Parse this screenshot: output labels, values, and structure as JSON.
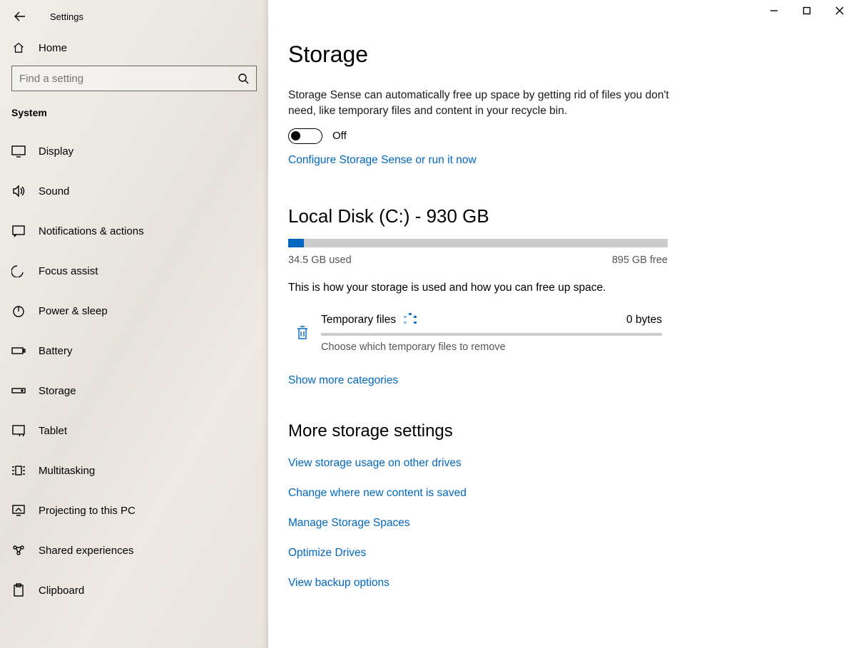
{
  "window": {
    "title": "Settings"
  },
  "sidebar": {
    "home_label": "Home",
    "search_placeholder": "Find a setting",
    "section_label": "System",
    "items": [
      {
        "label": "Display"
      },
      {
        "label": "Sound"
      },
      {
        "label": "Notifications & actions"
      },
      {
        "label": "Focus assist"
      },
      {
        "label": "Power & sleep"
      },
      {
        "label": "Battery"
      },
      {
        "label": "Storage"
      },
      {
        "label": "Tablet"
      },
      {
        "label": "Multitasking"
      },
      {
        "label": "Projecting to this PC"
      },
      {
        "label": "Shared experiences"
      },
      {
        "label": "Clipboard"
      }
    ]
  },
  "main": {
    "title": "Storage",
    "sense_desc": "Storage Sense can automatically free up space by getting rid of files you don't need, like temporary files and content in your recycle bin.",
    "toggle_label": "Off",
    "configure_link": "Configure Storage Sense or run it now",
    "disk_title": "Local Disk (C:) - 930 GB",
    "used_caption": "34.5 GB used",
    "free_caption": "895 GB free",
    "usage_note": "This is how your storage is used and how you can free up space.",
    "temp": {
      "title": "Temporary files",
      "size": "0 bytes",
      "sub": "Choose which temporary files to remove"
    },
    "show_more_link": "Show more categories",
    "more_heading": "More storage settings",
    "links": [
      "View storage usage on other drives",
      "Change where new content is saved",
      "Manage Storage Spaces",
      "Optimize Drives",
      "View backup options"
    ]
  }
}
